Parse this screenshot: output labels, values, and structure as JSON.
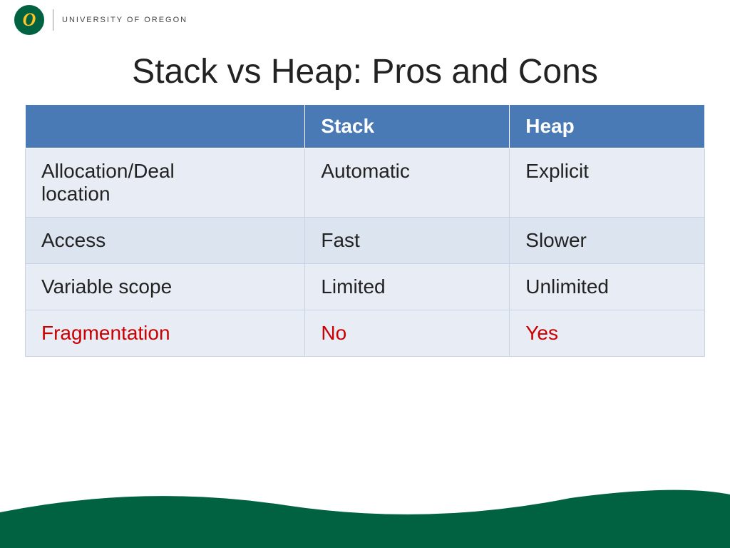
{
  "header": {
    "logo_letter": "O",
    "university_name": "UNIVERSITY OF OREGON"
  },
  "page": {
    "title": "Stack vs Heap: Pros and Cons"
  },
  "table": {
    "columns": [
      {
        "label": ""
      },
      {
        "label": "Stack"
      },
      {
        "label": "Heap"
      }
    ],
    "rows": [
      {
        "feature": "Allocation/Deallocation",
        "stack_value": "Automatic",
        "heap_value": "Explicit",
        "highlight": false
      },
      {
        "feature": "Access",
        "stack_value": "Fast",
        "heap_value": "Slower",
        "highlight": false
      },
      {
        "feature": "Variable scope",
        "stack_value": "Limited",
        "heap_value": "Unlimited",
        "highlight": false
      },
      {
        "feature": "Fragmentation",
        "stack_value": "No",
        "heap_value": "Yes",
        "highlight": true
      }
    ]
  },
  "colors": {
    "header_bg": "#4a7ab5",
    "header_text": "#ffffff",
    "row_odd": "#e8edf5",
    "row_even": "#dce4f0",
    "red_text": "#cc0000",
    "green_bottom": "#006241"
  }
}
